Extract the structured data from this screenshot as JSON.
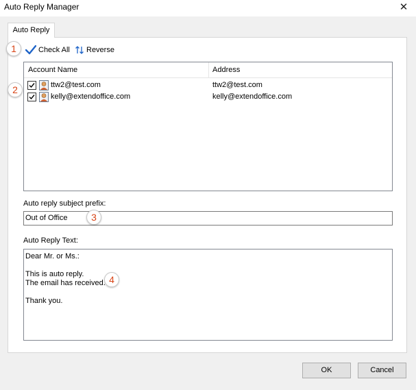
{
  "window": {
    "title": "Auto Reply Manager",
    "close_glyph": "✕"
  },
  "tabs": [
    {
      "label": "Auto Reply",
      "selected": true
    }
  ],
  "toolbar": {
    "check_all_label": "Check All",
    "reverse_label": "Reverse"
  },
  "accounts": {
    "columns": [
      "Account Name",
      "Address"
    ],
    "rows": [
      {
        "checked": true,
        "name": "ttw2@test.com",
        "address": "ttw2@test.com"
      },
      {
        "checked": true,
        "name": "kelly@extendoffice.com",
        "address": "kelly@extendoffice.com"
      }
    ]
  },
  "subject_prefix": {
    "label": "Auto reply subject prefix:",
    "value": "Out of Office"
  },
  "reply_text": {
    "label": "Auto Reply Text:",
    "lines": [
      "Dear Mr. or Ms.:",
      "",
      "This is auto reply.",
      "The email has received.",
      "",
      "Thank you."
    ]
  },
  "buttons": {
    "ok_label": "OK",
    "cancel_label": "Cancel"
  },
  "markers": [
    "1",
    "2",
    "3",
    "4"
  ],
  "colors": {
    "marker_text": "#d84315",
    "check_accent": "#1e64c8"
  },
  "icons": {
    "check_all": "checkmark-icon",
    "reverse": "reverse-arrows-icon",
    "account": "user-avatar-icon"
  }
}
